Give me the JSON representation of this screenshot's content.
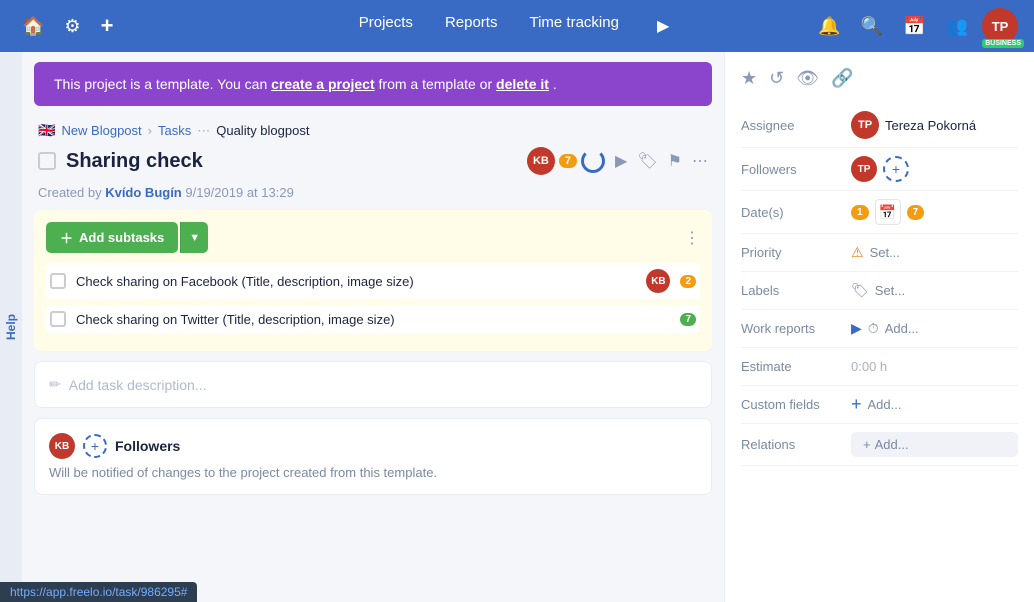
{
  "nav": {
    "home_icon": "🏠",
    "settings_icon": "⚙",
    "add_icon": "+",
    "projects_label": "Projects",
    "reports_label": "Reports",
    "timetracking_label": "Time tracking",
    "play_icon": "▶",
    "bell_icon": "🔔",
    "search_icon": "🔍",
    "calendar_icon": "📅",
    "team_icon": "👥",
    "avatar_initials": "TP",
    "business_badge": "BUSINESS"
  },
  "banner": {
    "text": "This project is a template. You can ",
    "create_link": "create a project",
    "middle_text": " from a template or ",
    "delete_link": "delete it",
    "end_text": "."
  },
  "breadcrumb": {
    "flag": "🇬🇧",
    "project": "New Blogpost",
    "tasks": "Tasks",
    "current": "Quality blogpost"
  },
  "task": {
    "title": "Sharing check",
    "avatar_initials": "KB",
    "badge_count": "7",
    "created_by": "Kvído Bugín",
    "created_date": "9/19/2019 at 13:29"
  },
  "subtasks": {
    "add_button": "Add subtasks",
    "more_icon": "⋮",
    "items": [
      {
        "title": "Check sharing on Facebook (Title, description, image size)",
        "avatar": "KB",
        "badge": "2",
        "badge_type": "orange"
      },
      {
        "title": "Check sharing on Twitter (Title, description, image size)",
        "avatar": null,
        "badge": "7",
        "badge_type": "green"
      }
    ]
  },
  "description": {
    "placeholder": "Add task description..."
  },
  "followers_section": {
    "title": "Followers",
    "avatar_initials": "KB",
    "description": "Will be notified of changes to the project created from this template."
  },
  "sidebar": {
    "icons": [
      "★",
      "↺",
      "👁",
      "🔗"
    ],
    "assignee_label": "Assignee",
    "assignee_name": "Tereza Pokorná",
    "assignee_avatar": "TP",
    "followers_label": "Followers",
    "follower_avatar": "TP",
    "dates_label": "Date(s)",
    "date_badge": "1 7",
    "priority_label": "Priority",
    "priority_icon": "⚠",
    "priority_value": "Set...",
    "labels_label": "Labels",
    "labels_icon": "🏷",
    "labels_value": "Set...",
    "work_reports_label": "Work reports",
    "work_reports_value": "Add...",
    "estimate_label": "Estimate",
    "estimate_value": "0:00 h",
    "custom_fields_label": "Custom fields",
    "custom_fields_value": "Add...",
    "relations_label": "Relations",
    "relations_value": "Add..."
  },
  "status_bar": {
    "url": "https://app.freelo.io/task/986295#"
  }
}
